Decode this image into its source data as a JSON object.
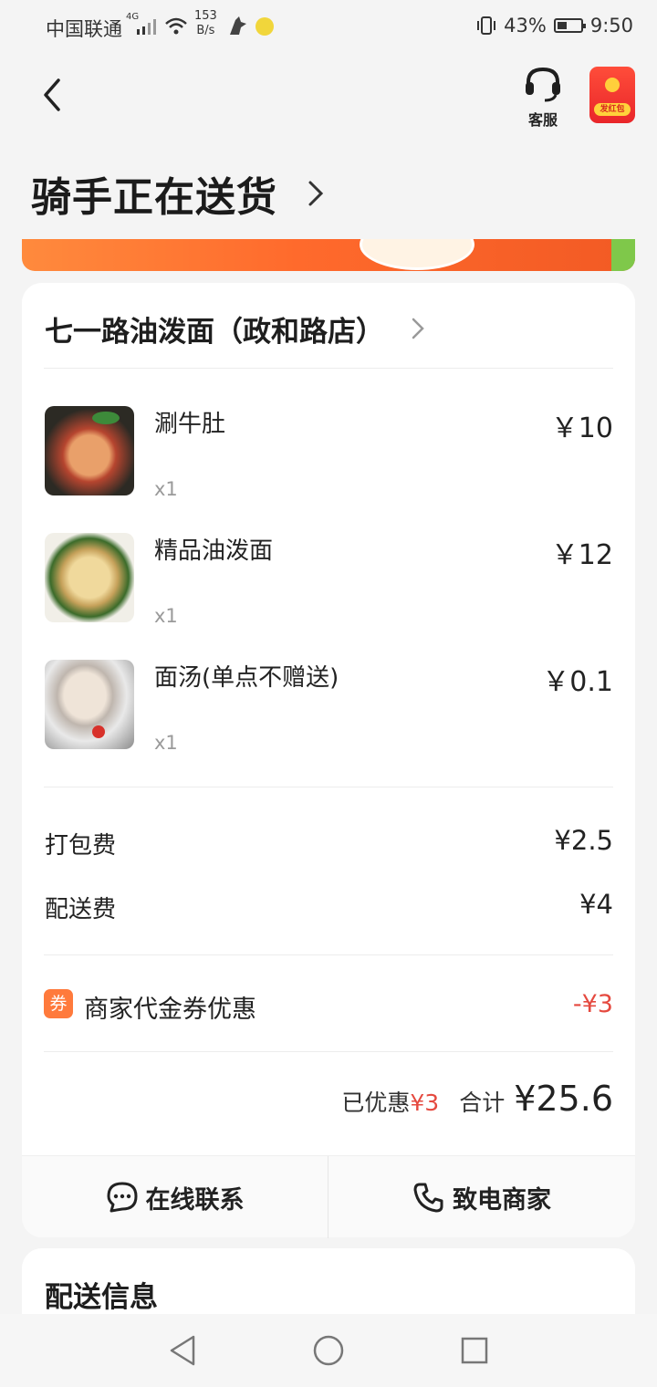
{
  "status_bar": {
    "carrier": "中国联通",
    "network": "4G",
    "speed_value": "153",
    "speed_unit": "B/s",
    "battery": "43%",
    "time": "9:50"
  },
  "header": {
    "customer_service_label": "客服",
    "red_packet_label": "发红包"
  },
  "page_title": "骑手正在送货",
  "order": {
    "shop_name": "七一路油泼面（政和路店）",
    "items": [
      {
        "name": "涮牛肚",
        "qty": "x1",
        "price": "￥10"
      },
      {
        "name": "精品油泼面",
        "qty": "x1",
        "price": "￥12"
      },
      {
        "name": "面汤(单点不赠送)",
        "qty": "x1",
        "price": "￥0.1"
      }
    ],
    "fees": [
      {
        "label": "打包费",
        "value": "¥2.5"
      },
      {
        "label": "配送费",
        "value": "¥4"
      }
    ],
    "coupon": {
      "icon_text": "券",
      "label": "商家代金券优惠",
      "value": "-¥3"
    },
    "summary": {
      "saved_label": "已优惠",
      "saved_value": "¥3",
      "total_label": "合计",
      "total_value": "¥25.6"
    },
    "actions": {
      "chat_label": "在线联系",
      "call_label": "致电商家"
    }
  },
  "delivery_info_title": "配送信息",
  "colors": {
    "accent_red": "#e5493f",
    "banner_orange": "#ff6a2c",
    "coupon_orange": "#ff7a3c"
  }
}
